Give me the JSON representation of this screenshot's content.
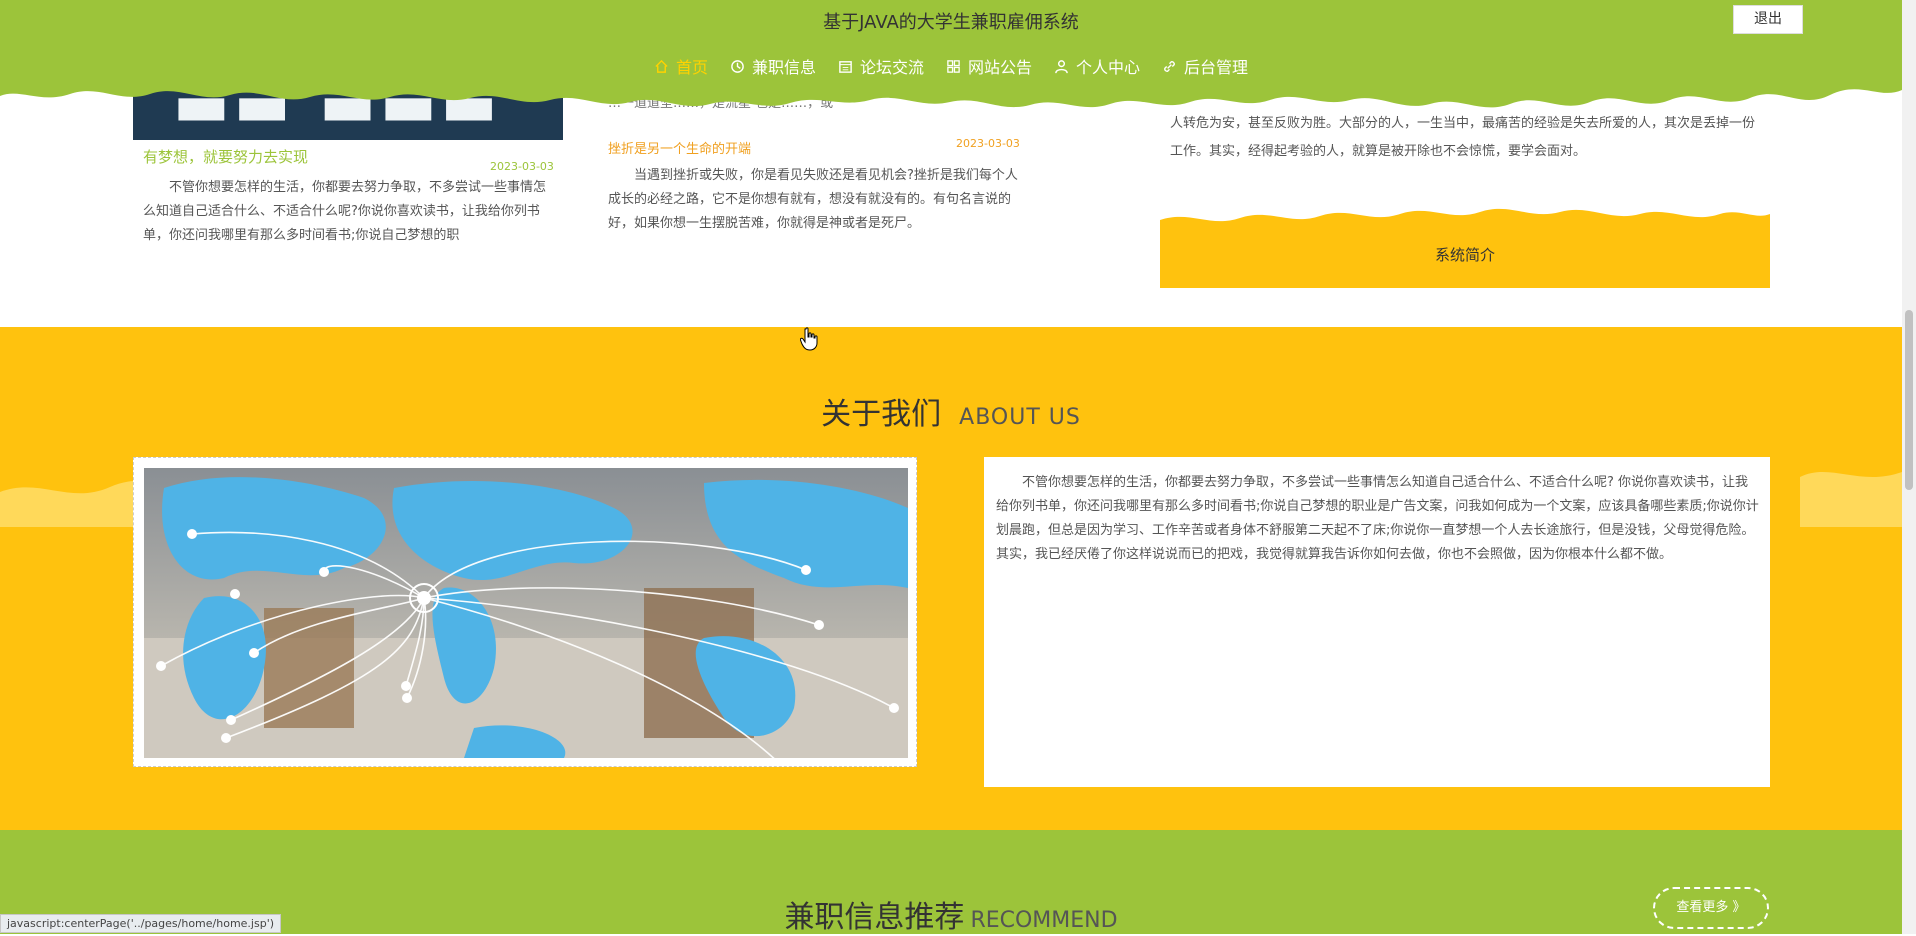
{
  "header": {
    "title": "基于JAVA的大学生兼职雇佣系统",
    "logout": "退出",
    "nav": [
      {
        "label": "首页",
        "icon": "home-icon"
      },
      {
        "label": "兼职信息",
        "icon": "clock-icon"
      },
      {
        "label": "论坛交流",
        "icon": "calendar-icon"
      },
      {
        "label": "网站公告",
        "icon": "grid-icon"
      },
      {
        "label": "个人中心",
        "icon": "user-icon"
      },
      {
        "label": "后台管理",
        "icon": "link-icon"
      }
    ]
  },
  "cards": {
    "card1": {
      "title": "有梦想，就要努力去实现",
      "date": "2023-03-03",
      "text": "不管你想要怎样的生活，你都要去努力争取，不多尝试一些事情怎么知道自己适合什么、不适合什么呢?你说你喜欢读书，让我给你列书单，你还问我哪里有那么多时间看书;你说自己梦想的职"
    },
    "card2": {
      "partial_line": "…一道道坚……，是流星 也是……，或",
      "title": "挫折是另一个生命的开端",
      "date": "2023-03-03",
      "text": "当遇到挫折或失败，你是看见失败还是看见机会?挫折是我们每个人成长的必经之路，它不是你想有就有，想没有就没有的。有句名言说的好，如果你想一生摆脱苦难，你就得是神或者是死尸。"
    },
    "card3": {
      "text": "人转危为安，甚至反败为胜。大部分的人，一生当中，最痛苦的经验是失去所爱的人，其次是丢掉一份工作。其实，经得起考验的人，就算是被开除也不会惊慌，要学会面对。"
    },
    "intro": "系统简介"
  },
  "about": {
    "title_cn": "关于我们",
    "title_en": "ABOUT US",
    "text": "不管你想要怎样的生活，你都要去努力争取，不多尝试一些事情怎么知道自己适合什么、不适合什么呢? 你说你喜欢读书，让我给你列书单，你还问我哪里有那么多时间看书;你说自己梦想的职业是广告文案，问我如何成为一个文案，应该具备哪些素质;你说你计划晨跑，但总是因为学习、工作辛苦或者身体不舒服第二天起不了床;你说你一直梦想一个人去长途旅行，但是没钱，父母觉得危险。其实，我已经厌倦了你这样说说而已的把戏，我觉得就算我告诉你如何去做，你也不会照做，因为你根本什么都不做。"
  },
  "recommend": {
    "title_cn": "兼职信息推荐",
    "title_en": "RECOMMEND",
    "more": "查看更多 》"
  },
  "status_bar": "javascript:centerPage('../pages/home/home.jsp')",
  "colors": {
    "green": "#9cc43a",
    "yellow": "#ffc20e",
    "active_nav": "#ffd200",
    "accent_orange": "#f0a020"
  }
}
